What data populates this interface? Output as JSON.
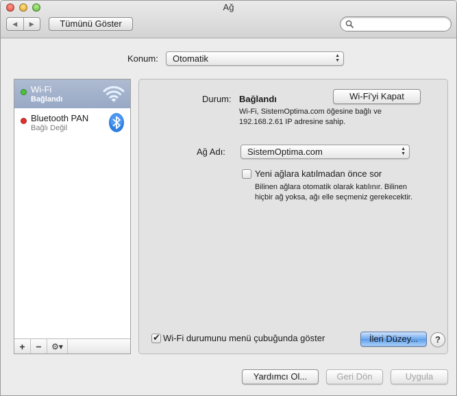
{
  "window": {
    "title": "Ağ"
  },
  "toolbar": {
    "back_icon": "◀",
    "forward_icon": "▶",
    "show_all_label": "Tümünü Göster",
    "search_placeholder": ""
  },
  "location": {
    "label": "Konum:",
    "value": "Otomatik"
  },
  "sidebar": {
    "services": [
      {
        "name": "Wi-Fi",
        "status": "Bağlandı",
        "status_color": "#4cc13d",
        "icon": "wifi-icon",
        "selected": true
      },
      {
        "name": "Bluetooth PAN",
        "status": "Bağlı Değil",
        "status_color": "#e3322b",
        "icon": "bluetooth-icon",
        "selected": false
      }
    ],
    "add_label": "+",
    "remove_label": "−",
    "gear_label": "⚙▾"
  },
  "detail": {
    "status_label": "Durum:",
    "status_value": "Bağlandı",
    "status_description": "Wi-Fi, SistemOptima.com öğesine bağlı ve 192.168.2.61 IP adresine sahip.",
    "turn_off_label": "Wi-Fi'yi Kapat",
    "network_name_label": "Ağ Adı:",
    "network_name_value": "SistemOptima.com",
    "ask_to_join_label": "Yeni ağlara katılmadan önce sor",
    "ask_to_join_checked": false,
    "ask_to_join_description": "Bilinen ağlara otomatik olarak katılınır. Bilinen hiçbir ağ yoksa, ağı elle seçmeniz gerekecektir.",
    "show_in_menubar_label": "Wi-Fi durumunu menü çubuğunda göster",
    "show_in_menubar_checked": true,
    "advanced_label": "İleri Düzey...",
    "help_label": "?"
  },
  "footer": {
    "assist_label": "Yardımcı Ol...",
    "revert_label": "Geri Dön",
    "apply_label": "Uygula"
  }
}
